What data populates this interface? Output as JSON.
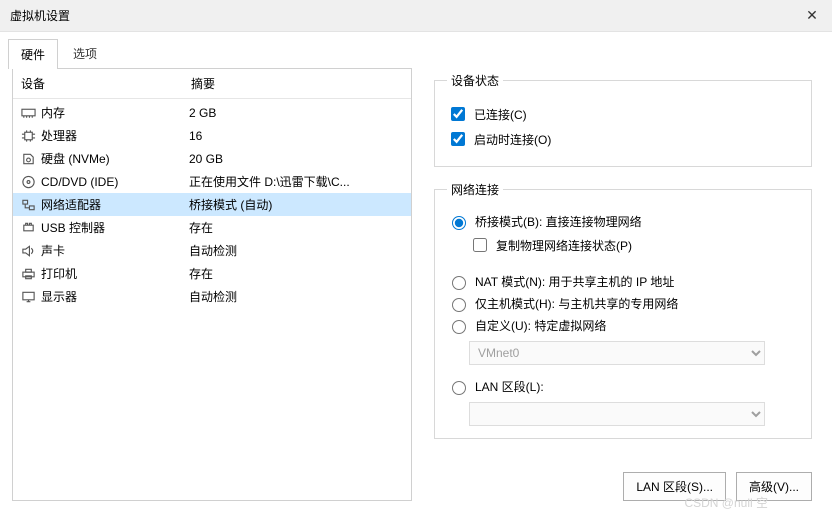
{
  "window": {
    "title": "虚拟机设置"
  },
  "tabs": {
    "hardware": "硬件",
    "options": "选项",
    "active": "hardware"
  },
  "headers": {
    "device": "设备",
    "summary": "摘要"
  },
  "devices": [
    {
      "name": "内存",
      "summary": "2 GB",
      "icon": "memory"
    },
    {
      "name": "处理器",
      "summary": "16",
      "icon": "cpu"
    },
    {
      "name": "硬盘 (NVMe)",
      "summary": "20 GB",
      "icon": "disk"
    },
    {
      "name": "CD/DVD (IDE)",
      "summary": "正在使用文件 D:\\迅雷下载\\C...",
      "icon": "cd"
    },
    {
      "name": "网络适配器",
      "summary": "桥接模式 (自动)",
      "icon": "network",
      "selected": true
    },
    {
      "name": "USB 控制器",
      "summary": "存在",
      "icon": "usb"
    },
    {
      "name": "声卡",
      "summary": "自动检测",
      "icon": "sound"
    },
    {
      "name": "打印机",
      "summary": "存在",
      "icon": "printer"
    },
    {
      "name": "显示器",
      "summary": "自动检测",
      "icon": "display"
    }
  ],
  "status": {
    "legend": "设备状态",
    "connected": "已连接(C)",
    "connectAtPowerOn": "启动时连接(O)"
  },
  "netconn": {
    "legend": "网络连接",
    "bridged": "桥接模式(B): 直接连接物理网络",
    "replicate": "复制物理网络连接状态(P)",
    "nat": "NAT 模式(N): 用于共享主机的 IP 地址",
    "hostonly": "仅主机模式(H): 与主机共享的专用网络",
    "custom": "自定义(U): 特定虚拟网络",
    "customNet": "VMnet0",
    "lanSegment": "LAN 区段(L):",
    "lanValue": ""
  },
  "buttons": {
    "lanSegments": "LAN 区段(S)...",
    "advanced": "高级(V)..."
  },
  "watermark": "CSDN @null 空"
}
